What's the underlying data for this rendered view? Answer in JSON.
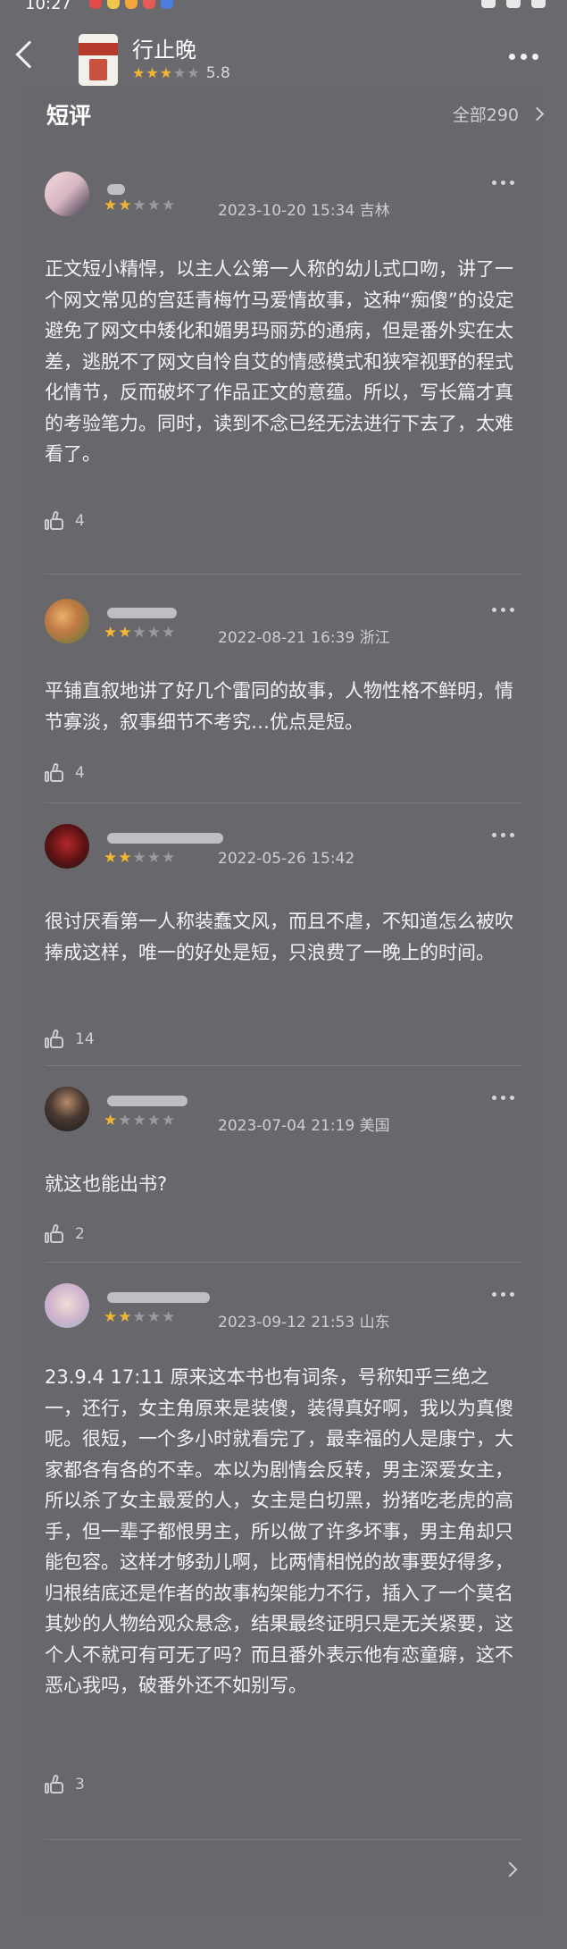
{
  "status": {
    "time": "10:27"
  },
  "header": {
    "book_title": "行止晚",
    "rating": "5.8",
    "stars": 3
  },
  "section": {
    "title": "短评",
    "all_label": "全部290"
  },
  "reviews": [
    {
      "stars": 2,
      "meta": "2023-10-20 15:34 吉林",
      "body": "正文短小精悍，以主人公第一人称的幼儿式口吻，讲了一个网文常见的宫廷青梅竹马爱情故事，这种“痴傻”的设定避免了网文中矮化和媚男玛丽苏的通病，但是番外实在太差，逃脱不了网文自怜自艾的情感模式和狭窄视野的程式化情节，反而破坏了作品正文的意蕴。所以，写长篇才真的考验笔力。同时，读到不念已经无法进行下去了，太难看了。",
      "likes": "4"
    },
    {
      "stars": 2,
      "meta": "2022-08-21 16:39 浙江",
      "body": "平铺直叙地讲了好几个雷同的故事，人物性格不鲜明，情节寡淡，叙事细节不考究…优点是短。",
      "likes": "4"
    },
    {
      "stars": 2,
      "meta": "2022-05-26 15:42",
      "body": "很讨厌看第一人称装蠢文风，而且不虐，不知道怎么被吹捧成这样，唯一的好处是短，只浪费了一晚上的时间。",
      "likes": "14"
    },
    {
      "stars": 1,
      "meta": "2023-07-04 21:19 美国",
      "body": "就这也能出书?",
      "likes": "2"
    },
    {
      "stars": 2,
      "meta": "2023-09-12 21:53 山东",
      "body": "23.9.4 17:11 原来这本书也有词条，号称知乎三绝之一，还行，女主角原来是装傻，装得真好啊，我以为真傻呢。很短，一个多小时就看完了，最幸福的人是康宁，大家都各有各的不幸。本以为剧情会反转，男主深爱女主，所以杀了女主最爱的人，女主是白切黑，扮猪吃老虎的高手，但一辈子都恨男主，所以做了许多坏事，男主角却只能包容。这样才够劲儿啊，比两情相悦的故事要好得多，归根结底还是作者的故事构架能力不行，插入了一个莫名其妙的人物给观众悬念，结果最终证明只是无关紧要，这个人不就可有可无了吗？而且番外表示他有恋童癖，这不恶心我吗，破番外还不如别写。",
      "likes": "3"
    }
  ]
}
